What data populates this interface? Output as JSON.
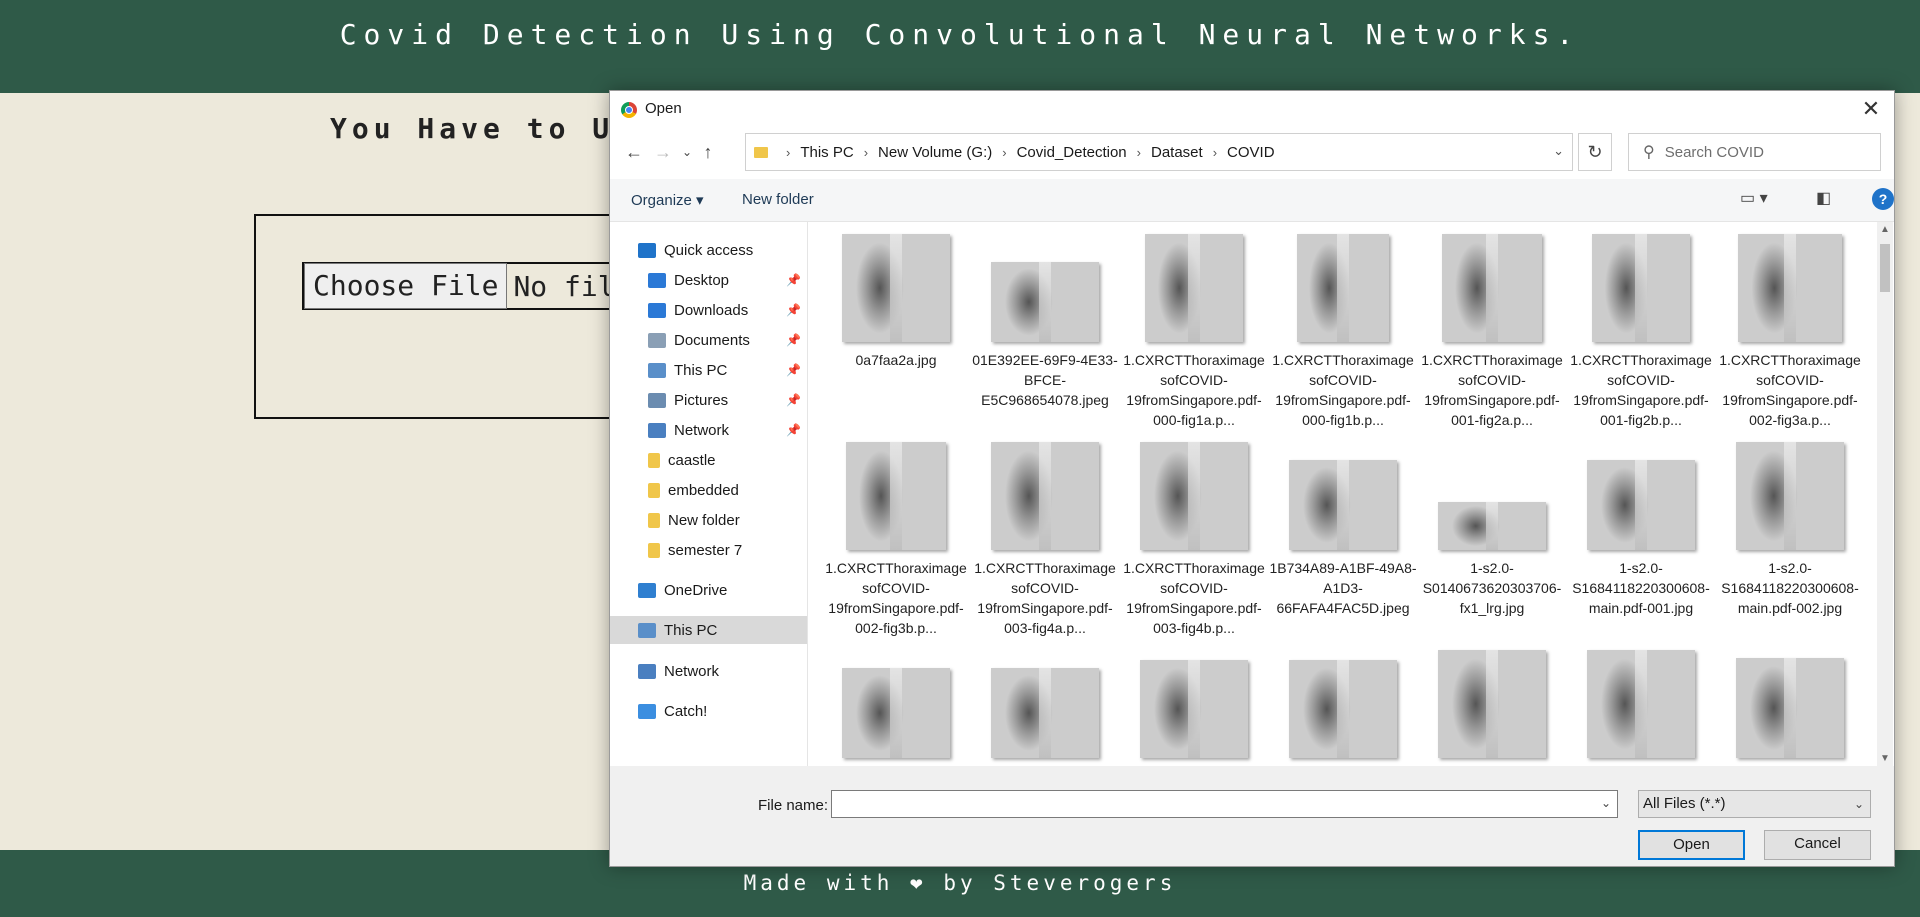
{
  "page": {
    "title": "Covid Detection Using Convolutional Neural Networks.",
    "upload_heading": "You Have to Upl",
    "choose_file_label": "Choose File",
    "no_file_text": "No fil",
    "footer": "Made with ❤ by Steverogers"
  },
  "dialog": {
    "title": "Open",
    "breadcrumbs": [
      "This PC",
      "New Volume (G:)",
      "Covid_Detection",
      "Dataset",
      "COVID"
    ],
    "search_placeholder": "Search COVID",
    "toolbar": {
      "organize": "Organize ▾",
      "new_folder": "New folder",
      "help": "?"
    },
    "sidebar": [
      {
        "label": "Quick access",
        "icon": "star-icon",
        "pinned": false
      },
      {
        "label": "Desktop",
        "icon": "desktop-icon",
        "pinned": true
      },
      {
        "label": "Downloads",
        "icon": "download-icon",
        "pinned": true
      },
      {
        "label": "Documents",
        "icon": "documents-icon",
        "pinned": true
      },
      {
        "label": "This PC",
        "icon": "pc-icon",
        "pinned": true
      },
      {
        "label": "Pictures",
        "icon": "pictures-icon",
        "pinned": true
      },
      {
        "label": "Network",
        "icon": "network-icon",
        "pinned": true
      },
      {
        "label": "caastle",
        "icon": "folder-icon",
        "pinned": false
      },
      {
        "label": "embedded",
        "icon": "folder-icon",
        "pinned": false
      },
      {
        "label": "New folder",
        "icon": "folder-icon",
        "pinned": false
      },
      {
        "label": "semester 7",
        "icon": "folder-icon",
        "pinned": false
      },
      {
        "label": "OneDrive",
        "icon": "cloud-icon",
        "pinned": false
      },
      {
        "label": "This PC",
        "icon": "pc-icon",
        "pinned": false,
        "selected": true
      },
      {
        "label": "Network",
        "icon": "network-icon",
        "pinned": false
      },
      {
        "label": "Catch!",
        "icon": "catch-icon",
        "pinned": false
      }
    ],
    "files": [
      "0a7faa2a.jpg",
      "01E392EE-69F9-4E33-BFCE-E5C968654078.jpeg",
      "1.CXRCTThoraximagesofCOVID-19fromSingapore.pdf-000-fig1a.p...",
      "1.CXRCTThoraximagesofCOVID-19fromSingapore.pdf-000-fig1b.p...",
      "1.CXRCTThoraximagesofCOVID-19fromSingapore.pdf-001-fig2a.p...",
      "1.CXRCTThoraximagesofCOVID-19fromSingapore.pdf-001-fig2b.p...",
      "1.CXRCTThoraximagesofCOVID-19fromSingapore.pdf-002-fig3a.p...",
      "1.CXRCTThoraximagesofCOVID-19fromSingapore.pdf-002-fig3b.p...",
      "1.CXRCTThoraximagesofCOVID-19fromSingapore.pdf-003-fig4a.p...",
      "1.CXRCTThoraximagesofCOVID-19fromSingapore.pdf-003-fig4b.p...",
      "1B734A89-A1BF-49A8-A1D3-66FAFA4FAC5D.jpeg",
      "1-s2.0-S0140673620303706-fx1_lrg.jpg",
      "1-s2.0-S1684118220300608-main.pdf-001.jpg",
      "1-s2.0-S1684118220300608-main.pdf-002.jpg",
      "",
      "",
      "",
      "",
      "",
      "",
      ""
    ],
    "file_name_label": "File name:",
    "file_name_value": "",
    "file_type": "All Files (*.*)",
    "open_label": "Open",
    "cancel_label": "Cancel"
  }
}
